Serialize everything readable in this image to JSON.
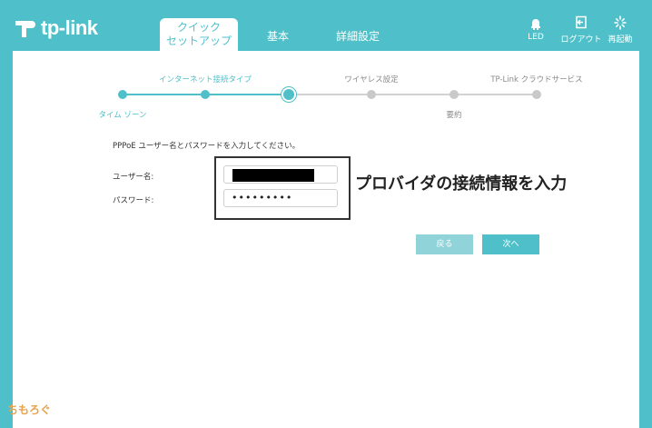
{
  "brand": {
    "name": "tp-link"
  },
  "tabs": [
    {
      "label_line1": "クイック",
      "label_line2": "セットアップ"
    },
    {
      "label": "基本"
    },
    {
      "label": "詳細設定"
    }
  ],
  "header_actions": [
    {
      "icon": "led-icon",
      "label": "LED"
    },
    {
      "icon": "logout-icon",
      "label": "ログアウト"
    },
    {
      "icon": "reboot-icon",
      "label": "再起動"
    }
  ],
  "stepper": {
    "steps": [
      {
        "label": "タイム ゾーン",
        "state": "done"
      },
      {
        "label": "",
        "state": "done"
      },
      {
        "label": "インターネット接続タイプ",
        "state": "current"
      },
      {
        "label": "ワイヤレス設定",
        "state": "todo"
      },
      {
        "label": "要約",
        "state": "todo"
      },
      {
        "label": "TP-Link クラウドサービス",
        "state": "todo"
      }
    ]
  },
  "form": {
    "instruction": "PPPoE ユーザー名とパスワードを入力してください。",
    "username_label": "ユーザー名:",
    "password_label": "パスワード:",
    "password_value": "•••••••••"
  },
  "annotation": "プロバイダの接続情報を入力",
  "buttons": {
    "back": "戻る",
    "next": "次へ"
  },
  "watermark": "ちもろぐ",
  "colors": {
    "accent": "#4fc0c9",
    "accent_light": "#90d3d9",
    "inactive": "#c9c9c9"
  }
}
